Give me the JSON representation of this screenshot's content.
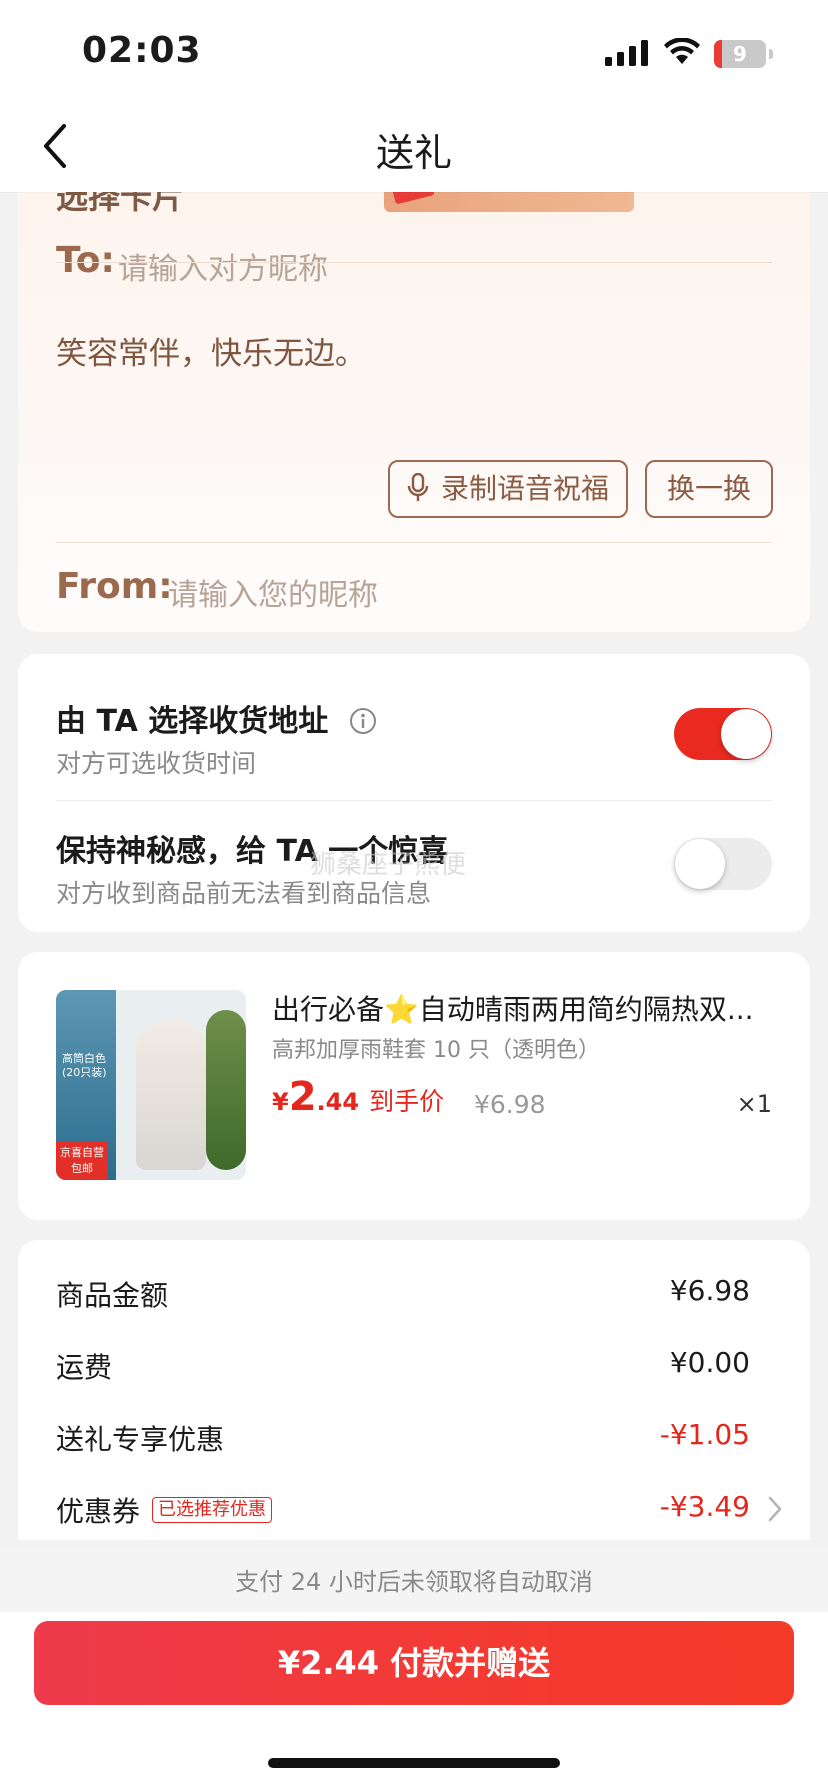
{
  "status_bar": {
    "time": "02:03",
    "battery": "9"
  },
  "nav": {
    "title": "送礼",
    "back_icon": "chevron-left-icon"
  },
  "greeting": {
    "cut_title": "选择卡片",
    "to_label": "To:",
    "to_placeholder": "请输入对方昵称",
    "message": "笑容常伴，快乐无边。",
    "record_button": "录制语音祝福",
    "swap_button": "换一换",
    "from_label": "From:",
    "from_placeholder": "请输入您的昵称",
    "accent_color": "#9b6a4e"
  },
  "options": {
    "address": {
      "title": "由 TA 选择收货地址",
      "subtitle": "对方可选收货时间",
      "enabled": true
    },
    "mystery": {
      "title": "保持神秘感，给 TA 一个惊喜",
      "subtitle": "对方收到商品前无法看到商品信息",
      "enabled": false
    },
    "watermark": "狮桑座子熊便"
  },
  "product": {
    "name": "出行必备⭐自动晴雨两用简约隔热双...",
    "spec": "高邦加厚雨鞋套 10 只（透明色）",
    "price_symbol": "¥",
    "price_int": "2",
    "price_dec": ".44",
    "price_label": "到手价",
    "original_price": "¥6.98",
    "quantity": "×1",
    "thumb_box_text": "高筒白色\n(20只装)",
    "thumb_badge": "京喜自营\n包邮"
  },
  "summary": {
    "rows": [
      {
        "label": "商品金额",
        "value": "¥6.98"
      },
      {
        "label": "运费",
        "value": "¥0.00"
      },
      {
        "label": "送礼专享优惠",
        "value": "-¥1.05"
      },
      {
        "label": "优惠券",
        "value": "-¥3.49",
        "tag": "已选推荐优惠"
      }
    ]
  },
  "footer": {
    "notice": "支付 24 小时后未领取将自动取消",
    "pay_button": "¥2.44 付款并赠送",
    "brand_color": "#f33a34"
  }
}
